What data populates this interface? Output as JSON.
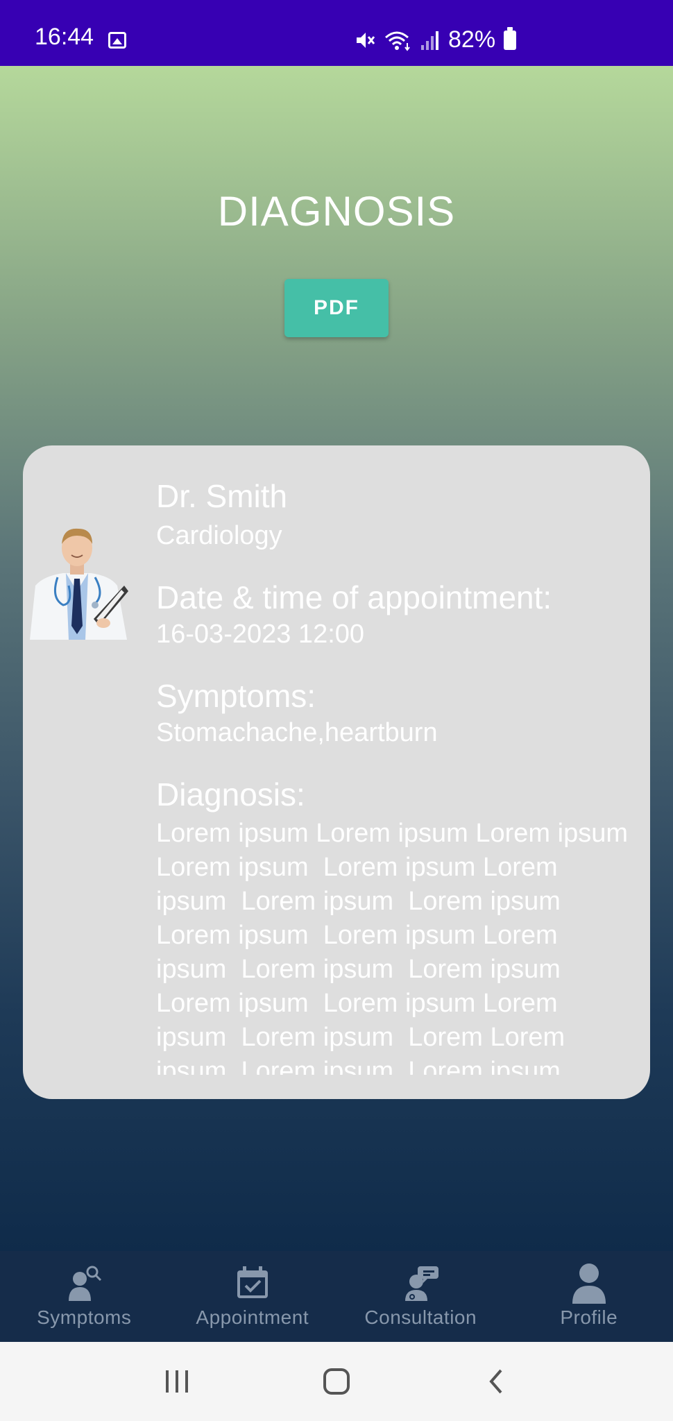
{
  "status_bar": {
    "time": "16:44",
    "battery": "82%"
  },
  "page": {
    "title": "DIAGNOSIS",
    "pdf_label": "PDF"
  },
  "card": {
    "doctor_name": "Dr. Smith",
    "specialty": "Cardiology",
    "date_label": "Date & time of appointment:",
    "date_value": "16-03-2023 12:00",
    "symptoms_label": "Symptoms:",
    "symptoms_value": "Stomachache,heartburn",
    "diagnosis_label": "Diagnosis:",
    "diagnosis_value": "Lorem ipsum Lorem ipsum Lorem ipsum Lorem ipsum  Lorem ipsum Lorem ipsum  Lorem ipsum  Lorem ipsum  Lorem ipsum  Lorem ipsum Lorem ipsum  Lorem ipsum  Lorem ipsum  Lorem ipsum  Lorem ipsum Lorem ipsum  Lorem ipsum  Lorem Lorem ipsum  Lorem ipsum  Lorem ipsum"
  },
  "bottom_nav": {
    "items": [
      {
        "label": "Symptoms",
        "icon": "user-search-icon"
      },
      {
        "label": "Appointment",
        "icon": "calendar-check-icon"
      },
      {
        "label": "Consultation",
        "icon": "doctor-chat-icon"
      },
      {
        "label": "Profile",
        "icon": "person-icon"
      }
    ]
  },
  "colors": {
    "status_bar": "#3700b3",
    "pdf_button": "#45bfa7",
    "card": "#dedede",
    "nav_bar": "#152c4a",
    "nav_icon": "#8898ac"
  }
}
